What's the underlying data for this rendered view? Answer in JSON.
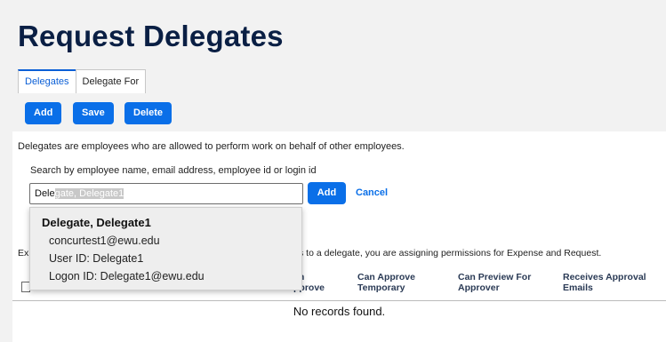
{
  "page": {
    "title": "Request Delegates"
  },
  "tabs": [
    {
      "label": "Delegates"
    },
    {
      "label": "Delegate For"
    }
  ],
  "toolbar": {
    "add_label": "Add",
    "save_label": "Save",
    "delete_label": "Delete"
  },
  "description": "Delegates are employees who are allowed to perform work on behalf of other employees.",
  "search": {
    "label": "Search by employee name, email address, employee id or login id",
    "typed": "Dele",
    "autocompleted": "gate, Delegate1",
    "add_label": "Add",
    "cancel_label": "Cancel"
  },
  "info": {
    "left": "Ex",
    "right": "s to a delegate, you are assigning permissions for Expense and Request."
  },
  "table": {
    "headers": [
      "an\npprove",
      "Can Approve\nTemporary",
      "Can Preview For\nApprover",
      "Receives Approval\nEmails"
    ],
    "empty_text": "No records found."
  },
  "suggestion": {
    "name": "Delegate, Delegate1",
    "email": "concurtest1@ewu.edu",
    "user_id": "User ID: Delegate1",
    "logon_id": "Logon ID: Delegate1@ewu.edu"
  },
  "colors": {
    "accent": "#0a6fe8",
    "title": "#0a1f44"
  }
}
